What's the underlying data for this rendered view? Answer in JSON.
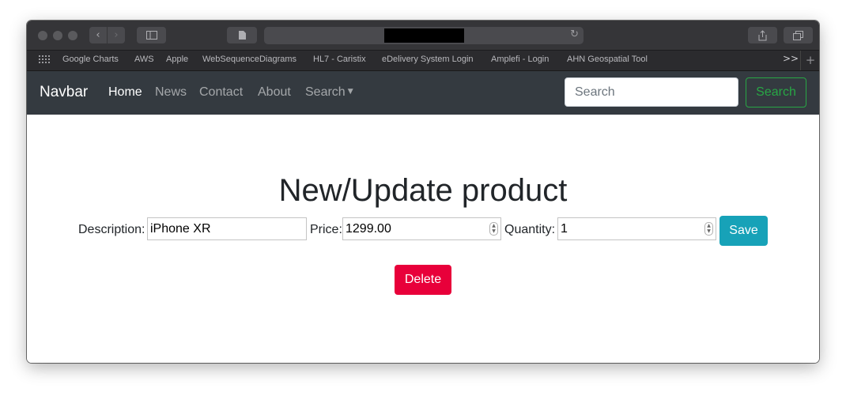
{
  "browser": {
    "url_text": "",
    "bookmarks": [
      "Google Charts",
      "AWS",
      "Apple",
      "WebSequenceDiagrams",
      "HL7 - Caristix",
      "eDelivery System Login",
      "Amplefi - Login",
      "AHN Geospatial Tool"
    ],
    "more_label": ">>",
    "plus_label": "+"
  },
  "navbar": {
    "brand": "Navbar",
    "links": [
      "Home",
      "News",
      "Contact",
      "About",
      "Search"
    ],
    "search_placeholder": "Search",
    "search_button": "Search"
  },
  "form": {
    "title": "New/Update product",
    "description_label": "Description:",
    "description_value": "iPhone XR",
    "price_label": "Price:",
    "price_value": "1299.00",
    "quantity_label": "Quantity:",
    "quantity_value": "1",
    "save_label": "Save",
    "delete_label": "Delete"
  },
  "colors": {
    "navbar_bg": "#343a40",
    "save_button": "#17a2b8",
    "delete_button": "#e8003a",
    "search_button_outline": "#28a745"
  }
}
